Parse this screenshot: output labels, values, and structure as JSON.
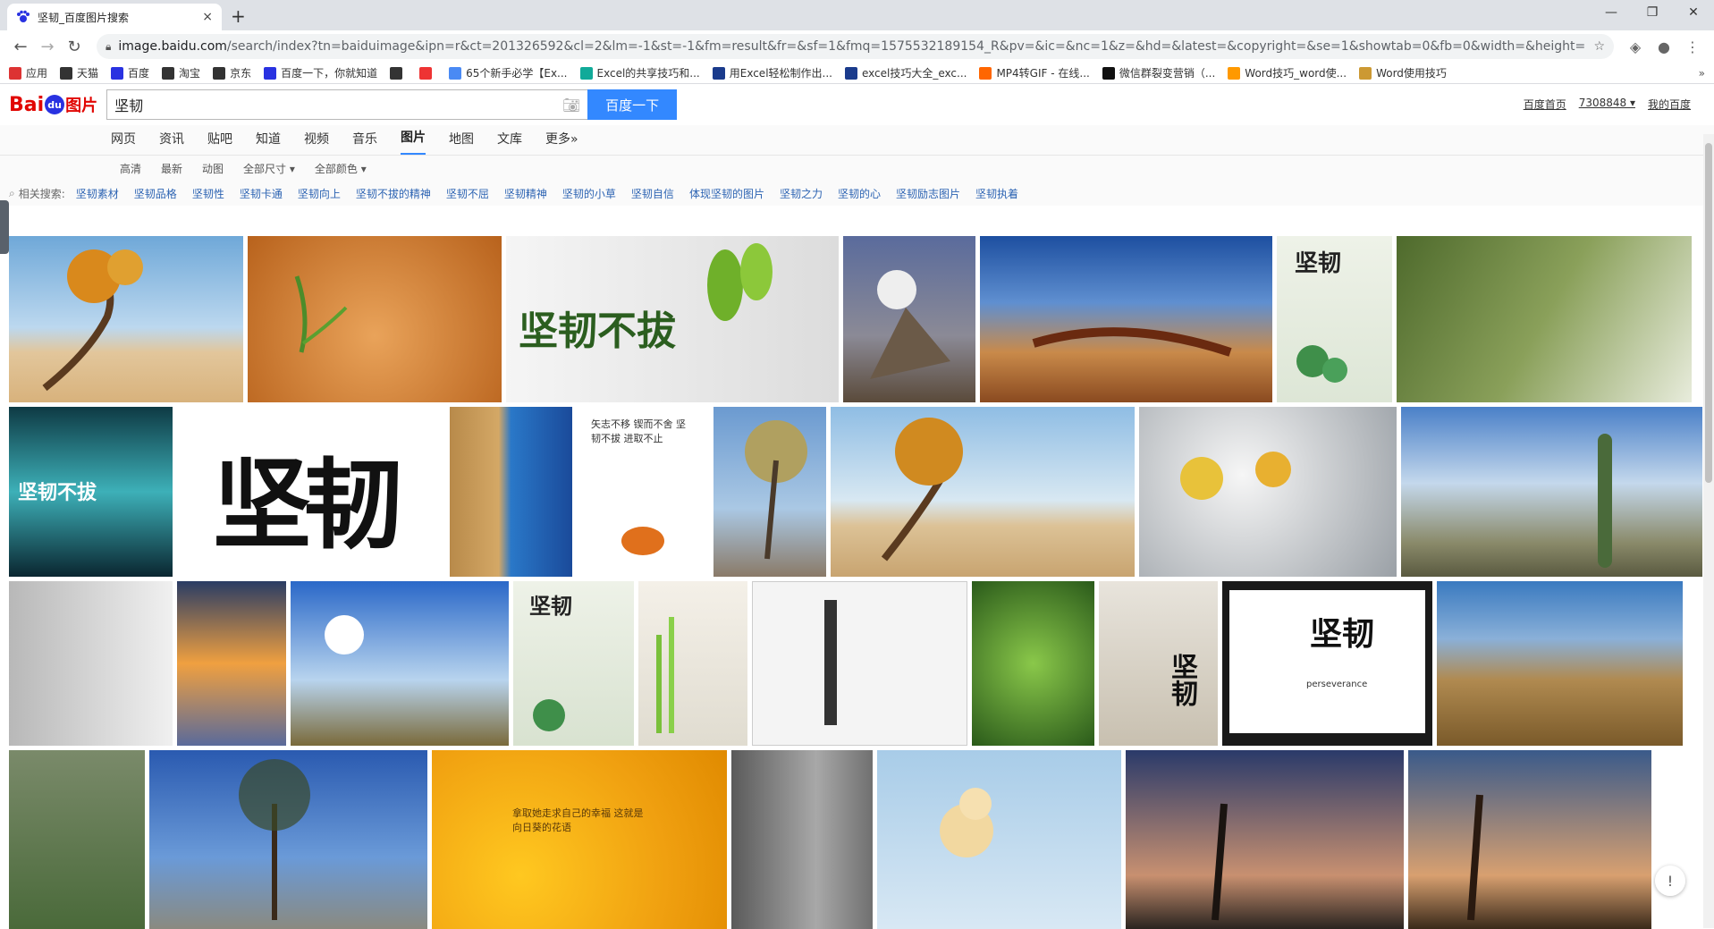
{
  "browser": {
    "tab_title": "坚韧_百度图片搜索",
    "close": "×",
    "new_tab": "+",
    "url_host": "image.baidu.com",
    "url_rest": "/search/index?tn=baiduimage&ipn=r&ct=201326592&cl=2&lm=-1&st=-1&fm=result&fr=&sf=1&fmq=1575532189154_R&pv=&ic=&nc=1&z=&hd=&latest=&copyright=&se=1&showtab=0&fb=0&width=&height=&fa...",
    "bookmarks": [
      {
        "label": "应用",
        "color": "#d33"
      },
      {
        "label": "天猫",
        "color": "#333"
      },
      {
        "label": "百度",
        "color": "#2932e1"
      },
      {
        "label": "淘宝",
        "color": "#333"
      },
      {
        "label": "京东",
        "color": "#333"
      },
      {
        "label": "百度一下，你就知道",
        "color": "#2932e1"
      },
      {
        "label": "",
        "color": "#333"
      },
      {
        "label": "",
        "color": "#e33"
      },
      {
        "label": "65个新手必学【Ex...",
        "color": "#4a8af4"
      },
      {
        "label": "Excel的共享技巧和...",
        "color": "#1a9"
      },
      {
        "label": "用Excel轻松制作出...",
        "color": "#1a3b8c"
      },
      {
        "label": "excel技巧大全_exc...",
        "color": "#1a3b8c"
      },
      {
        "label": "MP4转GIF - 在线...",
        "color": "#f60"
      },
      {
        "label": "微信群裂变营销（...",
        "color": "#111"
      },
      {
        "label": "Word技巧_word使...",
        "color": "#f90"
      },
      {
        "label": "Word使用技巧",
        "color": "#c93"
      }
    ]
  },
  "baidu": {
    "logo_bai": "Bai",
    "logo_du": "du",
    "logo_tp": "图片",
    "query": "坚韧",
    "search_button": "百度一下",
    "header_links": [
      "百度首页",
      "7308848 ▾",
      "我的百度"
    ],
    "categories": [
      "网页",
      "资讯",
      "贴吧",
      "知道",
      "视频",
      "音乐",
      "图片",
      "地图",
      "文库",
      "更多»"
    ],
    "active_category": "图片",
    "filters": [
      "高清",
      "最新",
      "动图",
      "全部尺寸 ▾",
      "全部颜色 ▾"
    ],
    "related_label": "相关搜索:",
    "related": [
      "坚韧素材",
      "坚韧品格",
      "坚韧性",
      "坚韧卡通",
      "坚韧向上",
      "坚韧不拔的精神",
      "坚韧不屈",
      "坚韧精神",
      "坚韧的小草",
      "坚韧自信",
      "体现坚韧的图片",
      "坚韧之力",
      "坚韧的心",
      "坚韧励志图片",
      "坚韧执着"
    ]
  },
  "image_texts": {
    "big_calligraphy": "坚韧",
    "poster_title": "坚韧不拔",
    "poster_motto": "矢志不移 锲而不舍 坚韧不拔 进取不止",
    "sunflower_text": "拿取她走求自己的幸福 这就是向日葵的花语",
    "perseverance": "perseverance"
  }
}
